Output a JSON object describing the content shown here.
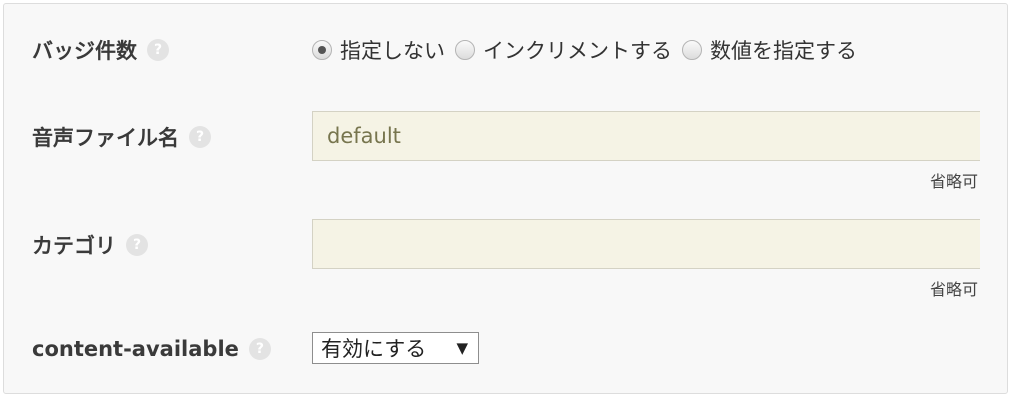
{
  "badge": {
    "label": "バッジ件数",
    "help": "?",
    "options": [
      {
        "label": "指定しない",
        "checked": true
      },
      {
        "label": "インクリメントする",
        "checked": false
      },
      {
        "label": "数値を指定する",
        "checked": false
      }
    ]
  },
  "sound": {
    "label": "音声ファイル名",
    "help": "?",
    "placeholder": "default",
    "value": "",
    "hint": "省略可"
  },
  "category": {
    "label": "カテゴリ",
    "help": "?",
    "value": "",
    "hint": "省略可"
  },
  "content_available": {
    "label": "content-available",
    "help": "?",
    "selected": "有効にする",
    "arrow_icon": "triangle-down"
  }
}
